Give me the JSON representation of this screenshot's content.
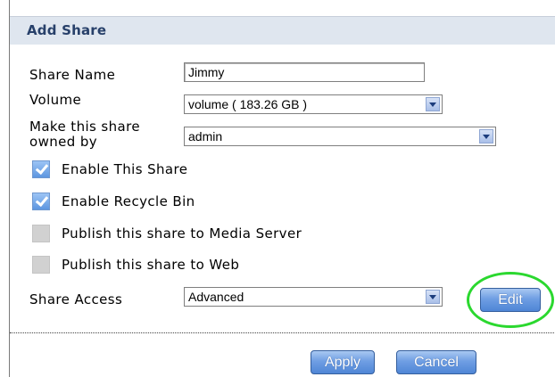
{
  "header": {
    "title": "Add Share"
  },
  "form": {
    "share_name_label": "Share Name",
    "share_name_value": "Jimmy",
    "volume_label": "Volume",
    "volume_value": "volume ( 183.26 GB )",
    "owner_label_line1": "Make this share",
    "owner_label_line2": "owned by",
    "owner_value": "admin",
    "checkboxes": [
      {
        "label": "Enable This Share",
        "checked": true
      },
      {
        "label": "Enable Recycle Bin",
        "checked": true
      },
      {
        "label": "Publish this share to Media Server",
        "checked": false
      },
      {
        "label": "Publish this share to Web",
        "checked": false
      }
    ],
    "share_access_label": "Share Access",
    "share_access_value": "Advanced",
    "edit_label": "Edit"
  },
  "footer": {
    "apply_label": "Apply",
    "cancel_label": "Cancel"
  },
  "colors": {
    "header_bg": "#dfe6ef",
    "title": "#27406a",
    "highlight": "#2bd82f",
    "button": "#4f86d6"
  }
}
